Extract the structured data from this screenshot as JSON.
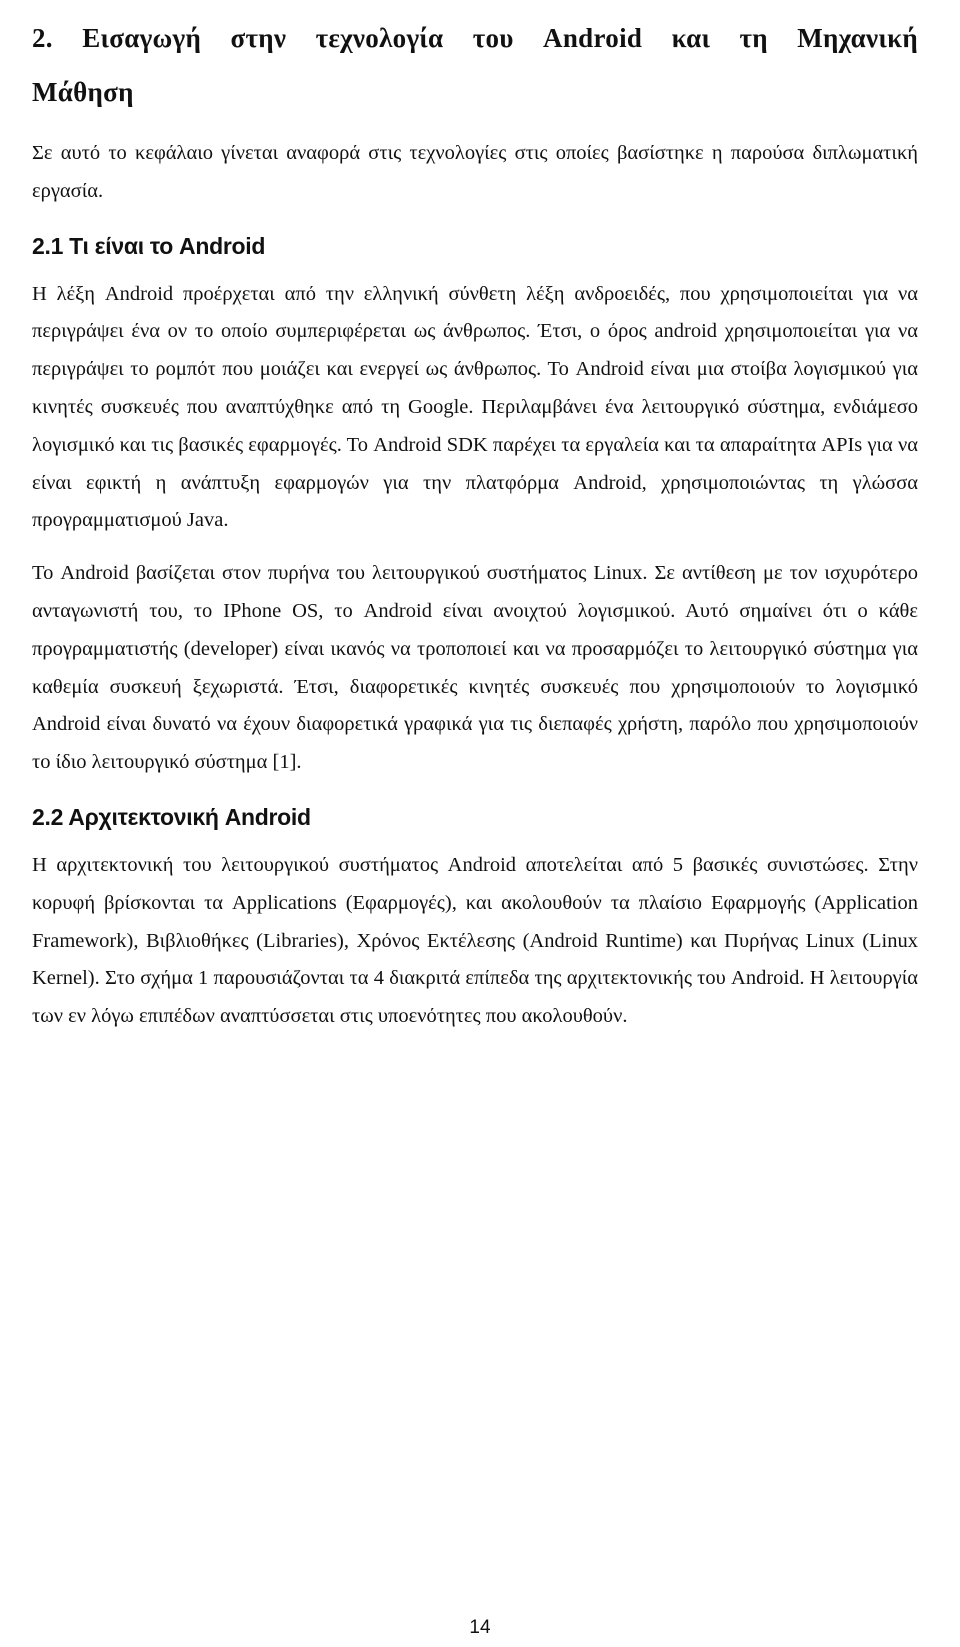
{
  "chapter": {
    "title_line1": "2. Εισαγωγή στην τεχνολογία του Android και τη Μηχανική",
    "title_line2": "Μάθηση",
    "intro": "Σε αυτό το κεφάλαιο γίνεται αναφορά στις τεχνολογίες στις οποίες βασίστηκε η παρούσα διπλωματική εργασία."
  },
  "sections": [
    {
      "heading": "2.1 Τι είναι το Android",
      "paragraphs": [
        "Η λέξη Android προέρχεται από την ελληνική σύνθετη λέξη ανδροειδές, που χρησιμοποιείται για να περιγράψει ένα ον το οποίο συμπεριφέρεται ως άνθρωπος. Έτσι, ο όρος android χρησιμοποιείται για να περιγράψει το ρομπότ που μοιάζει και ενεργεί ως άνθρωπος. Το Android είναι μια στοίβα λογισμικού για κινητές συσκευές που αναπτύχθηκε από τη Google. Περιλαμβάνει ένα λειτουργικό σύστημα, ενδιάμεσο λογισμικό και τις βασικές εφαρμογές. Το Android SDK παρέχει τα εργαλεία και τα απαραίτητα APIs για να είναι εφικτή η ανάπτυξη εφαρμογών για την πλατφόρμα Android, χρησιμοποιώντας τη γλώσσα προγραμματισμού Java.",
        "Το Android βασίζεται στον πυρήνα του λειτουργικού συστήματος Linux. Σε αντίθεση με τον ισχυρότερο ανταγωνιστή του, το IPhone OS, το Android είναι ανοιχτού λογισμικού. Αυτό σημαίνει ότι ο κάθε προγραμματιστής (developer) είναι ικανός να τροποποιεί και να προσαρμόζει το λειτουργικό σύστημα για καθεμία συσκευή ξεχωριστά. Έτσι, διαφορετικές κινητές συσκευές που χρησιμοποιούν το λογισμικό Android είναι δυνατό να έχουν διαφορετικά γραφικά για τις διεπαφές χρήστη, παρόλο που χρησιμοποιούν το ίδιο λειτουργικό σύστημα [1]."
      ]
    },
    {
      "heading": "2.2 Αρχιτεκτονική Android",
      "paragraphs": [
        "Η αρχιτεκτονική του λειτουργικού συστήματος Android αποτελείται από 5 βασικές συνιστώσες. Στην κορυφή βρίσκονται τα Applications (Εφαρμογές), και ακολουθούν τα πλαίσιο Εφαρμογής (Application Framework), Βιβλιοθήκες (Libraries), Χρόνος Εκτέλεσης (Android Runtime) και Πυρήνας Linux (Linux Kernel). Στο σχήμα 1 παρουσιάζονται τα 4 διακριτά επίπεδα της αρχιτεκτονικής του Android. Η λειτουργία των εν λόγω επιπέδων αναπτύσσεται στις υποενότητες που ακολουθούν."
      ]
    }
  ],
  "footer": {
    "page_number": "14"
  }
}
